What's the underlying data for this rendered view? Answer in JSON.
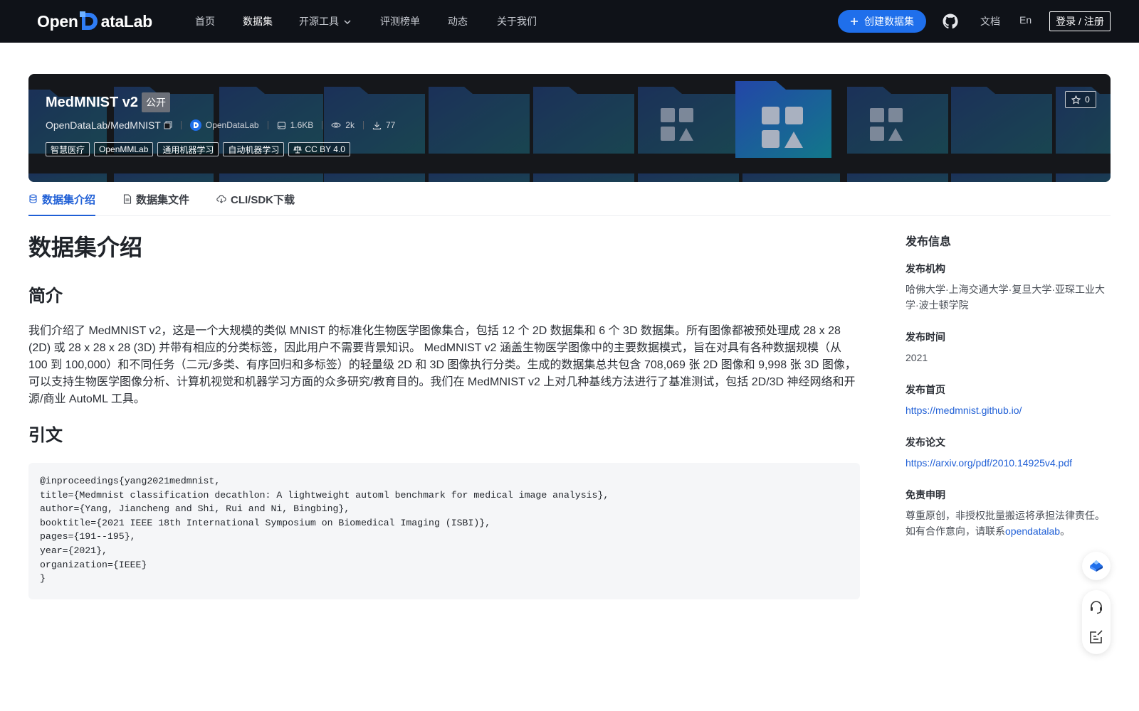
{
  "nav": {
    "logo_left": "Open",
    "logo_right": "ataLab",
    "links": [
      "首页",
      "数据集",
      "开源工具",
      "评测榜单",
      "动态",
      "关于我们"
    ],
    "create_label": "创建数据集",
    "docs_label": "文档",
    "lang_label": "En",
    "login_label": "登录 / 注册"
  },
  "dataset": {
    "title": "MedMNIST v2",
    "visibility": "公开",
    "path": "OpenDataLab/MedMNIST",
    "org": "OpenDataLab",
    "size": "1.6KB",
    "views": "2k",
    "downloads": "77",
    "stars": "0",
    "tags": [
      "智慧医疗",
      "OpenMMLab",
      "通用机器学习",
      "自动机器学习"
    ],
    "license": "CC BY 4.0"
  },
  "tabs": [
    "数据集介绍",
    "数据集文件",
    "CLI/SDK下载"
  ],
  "content": {
    "heading": "数据集介绍",
    "intro_heading": "简介",
    "intro_text": "我们介绍了 MedMNIST v2，这是一个大规模的类似 MNIST 的标准化生物医学图像集合，包括 12 个 2D 数据集和 6 个 3D 数据集。所有图像都被预处理成 28 x 28 (2D) 或 28 x 28 x 28 (3D) 并带有相应的分类标签，因此用户不需要背景知识。 MedMNIST v2 涵盖生物医学图像中的主要数据模式，旨在对具有各种数据规模（从 100 到 100,000）和不同任务（二元/多类、有序回归和多标签）的轻量级 2D 和 3D 图像执行分类。生成的数据集总共包含 708,069 张 2D 图像和 9,998 张 3D 图像，可以支持生物医学图像分析、计算机视觉和机器学习方面的众多研究/教育目的。我们在 MedMNIST v2 上对几种基线方法进行了基准测试，包括 2D/3D 神经网络和开源/商业 AutoML 工具。",
    "citation_heading": "引文",
    "citation": "@inproceedings{yang2021medmnist,\ntitle={Medmnist classification decathlon: A lightweight automl benchmark for medical image analysis},\nauthor={Yang, Jiancheng and Shi, Rui and Ni, Bingbing},\nbooktitle={2021 IEEE 18th International Symposium on Biomedical Imaging (ISBI)},\npages={191--195},\nyear={2021},\norganization={IEEE}\n}"
  },
  "sidebar": {
    "title": "发布信息",
    "org_label": "发布机构",
    "org_value": "哈佛大学·上海交通大学·复旦大学·亚琛工业大学·波士顿学院",
    "time_label": "发布时间",
    "time_value": "2021",
    "home_label": "发布首页",
    "home_value": "https://medmnist.github.io/",
    "paper_label": "发布论文",
    "paper_value": "https://arxiv.org/pdf/2010.14925v4.pdf",
    "disclaimer_label": "免责申明",
    "disclaimer_text": "尊重原创，非授权批量搬运将承担法律责任。如有合作意向，请联系",
    "disclaimer_link": "opendatalab",
    "disclaimer_end": "。"
  },
  "colors": {
    "accent": "#1f5fd6",
    "nav_bg": "#0f1218",
    "create_btn": "#1f6feb",
    "code_bg": "#f5f6f8"
  },
  "icons": [
    "github-icon",
    "plus-icon",
    "copy-icon",
    "database-icon",
    "eye-icon",
    "download-icon",
    "star-icon",
    "scale-icon",
    "file-icon",
    "cloud-icon",
    "chevron-down-icon",
    "headset-icon",
    "feedback-icon",
    "rocket-icon"
  ]
}
